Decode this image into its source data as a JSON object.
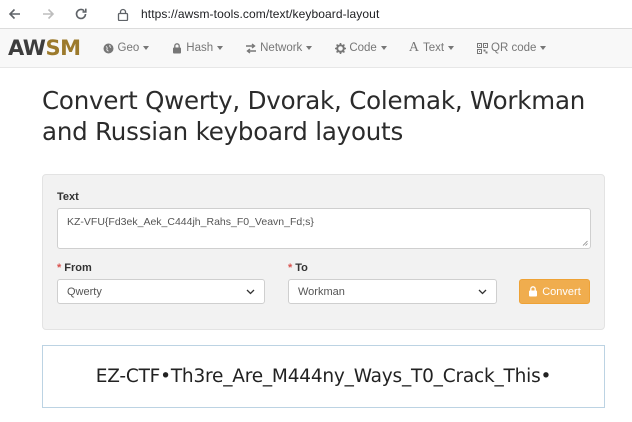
{
  "browser": {
    "url": "https://awsm-tools.com/text/keyboard-layout"
  },
  "navbar": {
    "brand": {
      "part1": "AW",
      "part2": "SM"
    },
    "items": [
      {
        "label": "Geo",
        "icon": "globe-icon"
      },
      {
        "label": "Hash",
        "icon": "lock-icon"
      },
      {
        "label": "Network",
        "icon": "exchange-icon"
      },
      {
        "label": "Code",
        "icon": "gear-icon"
      },
      {
        "label": "Text",
        "icon": "text-icon",
        "glyph": "A"
      },
      {
        "label": "QR code",
        "icon": "qrcode-icon"
      }
    ]
  },
  "page": {
    "title": "Convert Qwerty, Dvorak, Colemak, Workman and Russian keyboard layouts"
  },
  "form": {
    "text_label": "Text",
    "text_value": "KZ-VFU{Fd3ek_Aek_C444jh_Rahs_F0_Veavn_Fd;s}",
    "from_label": "From",
    "from_value": "Qwerty",
    "to_label": "To",
    "to_value": "Workman",
    "required_mark": "*",
    "convert_label": "Convert"
  },
  "result": {
    "text": "EZ-CTF•Th3re_Are_M444ny_Ways_T0_Crack_This•"
  },
  "colors": {
    "brand_dark": "#3d3d3d",
    "brand_gold": "#9c7a2c",
    "convert_button": "#f0ad4e",
    "required": "#d9534f",
    "result_border": "#bcd3e3"
  }
}
